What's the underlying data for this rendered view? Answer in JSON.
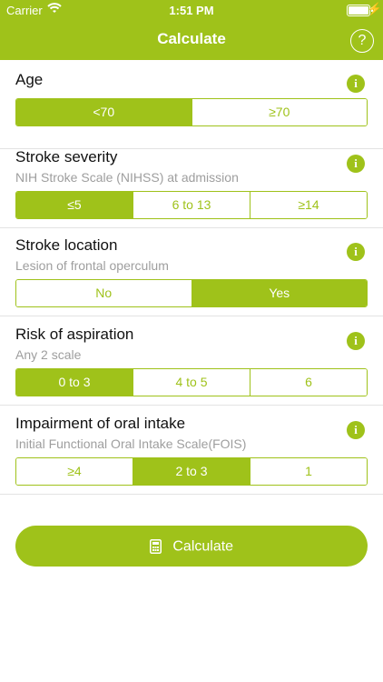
{
  "status_bar": {
    "carrier": "Carrier",
    "time": "1:51 PM"
  },
  "header": {
    "title": "Calculate",
    "help_label": "?"
  },
  "sections": [
    {
      "label": "Age",
      "sub": "",
      "options": [
        "<70",
        "≥70"
      ],
      "selected": 0
    },
    {
      "label": "Stroke severity",
      "sub": "NIH Stroke Scale (NIHSS) at admission",
      "options": [
        "≤5",
        "6 to 13",
        "≥14"
      ],
      "selected": 0
    },
    {
      "label": "Stroke location",
      "sub": "Lesion of frontal operculum",
      "options": [
        "No",
        "Yes"
      ],
      "selected": 1
    },
    {
      "label": "Risk of aspiration",
      "sub": "Any 2 scale",
      "options": [
        "0 to 3",
        "4 to 5",
        "6"
      ],
      "selected": 0
    },
    {
      "label": "Impairment of oral intake",
      "sub": "Initial Functional Oral Intake Scale(FOIS)",
      "options": [
        "≥4",
        "2 to 3",
        "1"
      ],
      "selected": 1
    }
  ],
  "info_label": "i",
  "calculate_button": {
    "label": "Calculate",
    "icon": "calculator-icon"
  },
  "colors": {
    "accent": "#9fc21a",
    "divider": "#e3e3e3",
    "subtext": "#9e9e9e"
  }
}
